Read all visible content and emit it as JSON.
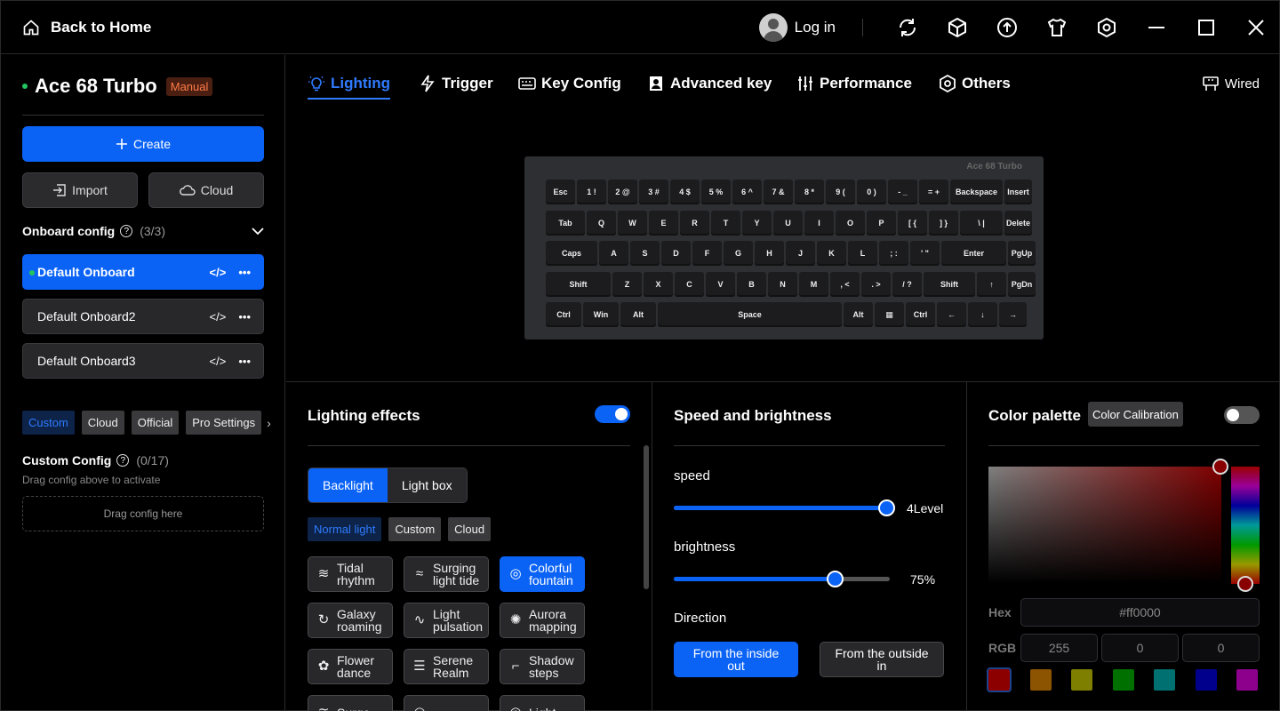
{
  "titlebar": {
    "back_label": "Back to Home",
    "login_label": "Log in",
    "icons": [
      "refresh-icon",
      "cube-icon",
      "upload-icon",
      "shirt-icon",
      "hexagon-settings-icon",
      "minimize-icon",
      "maximize-icon",
      "close-icon"
    ]
  },
  "sidebar": {
    "device_name": "Ace 68 Turbo",
    "mode_badge": "Manual",
    "create_label": "Create",
    "import_label": "Import",
    "cloud_label": "Cloud",
    "onboard_title": "Onboard config",
    "onboard_count": "(3/3)",
    "configs": [
      {
        "label": "Default Onboard",
        "active": true
      },
      {
        "label": "Default Onboard2",
        "active": false
      },
      {
        "label": "Default Onboard3",
        "active": false
      }
    ],
    "source_tabs": [
      "Custom",
      "Cloud",
      "Official",
      "Pro Settings"
    ],
    "custom_title": "Custom Config",
    "custom_count": "(0/17)",
    "custom_hint": "Drag config above to activate",
    "dropzone_label": "Drag config here"
  },
  "nav": {
    "tabs": [
      "Lighting",
      "Trigger",
      "Key Config",
      "Advanced key",
      "Performance",
      "Others"
    ],
    "active": "Lighting",
    "connection": "Wired"
  },
  "keyboard": {
    "brand": "Ace 68 Turbo",
    "rows": [
      [
        "Esc",
        "1 !",
        "2 @",
        "3 #",
        "4 $",
        "5 %",
        "6 ^",
        "7 &",
        "8 *",
        "9 (",
        "0 )",
        "- _",
        "= +",
        "Backspace",
        "Insert"
      ],
      [
        "Tab",
        "Q",
        "W",
        "E",
        "R",
        "T",
        "Y",
        "U",
        "I",
        "O",
        "P",
        "[ {",
        "] }",
        "\\ |",
        "Delete"
      ],
      [
        "Caps",
        "A",
        "S",
        "D",
        "F",
        "G",
        "H",
        "J",
        "K",
        "L",
        "; :",
        "' \"",
        "Enter",
        "PgUp"
      ],
      [
        "Shift",
        "Z",
        "X",
        "C",
        "V",
        "B",
        "N",
        "M",
        ", <",
        ". >",
        "/ ?",
        "Shift",
        "↑",
        "PgDn"
      ],
      [
        "Ctrl",
        "Win",
        "Alt",
        "Space",
        "Alt",
        "▦",
        "Ctrl",
        "←",
        "↓",
        "→"
      ]
    ]
  },
  "lighting": {
    "title": "Lighting effects",
    "enabled": true,
    "modes": [
      "Backlight",
      "Light box"
    ],
    "active_mode": "Backlight",
    "sub_tabs": [
      "Normal light",
      "Custom",
      "Cloud"
    ],
    "effects": [
      {
        "label": [
          "Tidal",
          "rhythm"
        ],
        "icon": "≋",
        "active": false
      },
      {
        "label": [
          "Surging",
          "light tide"
        ],
        "icon": "≈",
        "active": false
      },
      {
        "label": [
          "Colorful",
          "fountain"
        ],
        "icon": "◎",
        "active": true
      },
      {
        "label": [
          "Galaxy",
          "roaming"
        ],
        "icon": "↻",
        "active": false
      },
      {
        "label": [
          "Light",
          "pulsation"
        ],
        "icon": "∿",
        "active": false
      },
      {
        "label": [
          "Aurora",
          "mapping"
        ],
        "icon": "✺",
        "active": false
      },
      {
        "label": [
          "Flower",
          "dance"
        ],
        "icon": "✿",
        "active": false
      },
      {
        "label": [
          "Serene",
          "Realm"
        ],
        "icon": "☰",
        "active": false
      },
      {
        "label": [
          "Shadow",
          "steps"
        ],
        "icon": "⌐",
        "active": false
      },
      {
        "label": [
          "Surge",
          ""
        ],
        "icon": "≋",
        "active": false
      },
      {
        "label": [
          "",
          ""
        ],
        "icon": "◠",
        "active": false
      },
      {
        "label": [
          "Light",
          ""
        ],
        "icon": "◎",
        "active": false
      }
    ]
  },
  "speed": {
    "title": "Speed and brightness",
    "speed_label": "speed",
    "speed_value": "4Level",
    "speed_level": 1.0,
    "brightness_label": "brightness",
    "brightness_value": "75%",
    "brightness_level": 0.75,
    "direction_label": "Direction",
    "directions": [
      [
        "From the inside",
        "out"
      ],
      [
        "From the outside",
        "in"
      ]
    ],
    "active_direction": 0
  },
  "palette": {
    "title": "Color palette",
    "calibration_label": "Color Calibration",
    "calibration_enabled": false,
    "hex_label": "Hex",
    "hex_value": "#ff0000",
    "rgb_label": "RGB",
    "r": "255",
    "g": "0",
    "b": "0",
    "swatches": [
      "#ff0000",
      "#ff9900",
      "#e6e600",
      "#00cc00",
      "#00cccc",
      "#0000ff",
      "#ff00ff"
    ]
  }
}
